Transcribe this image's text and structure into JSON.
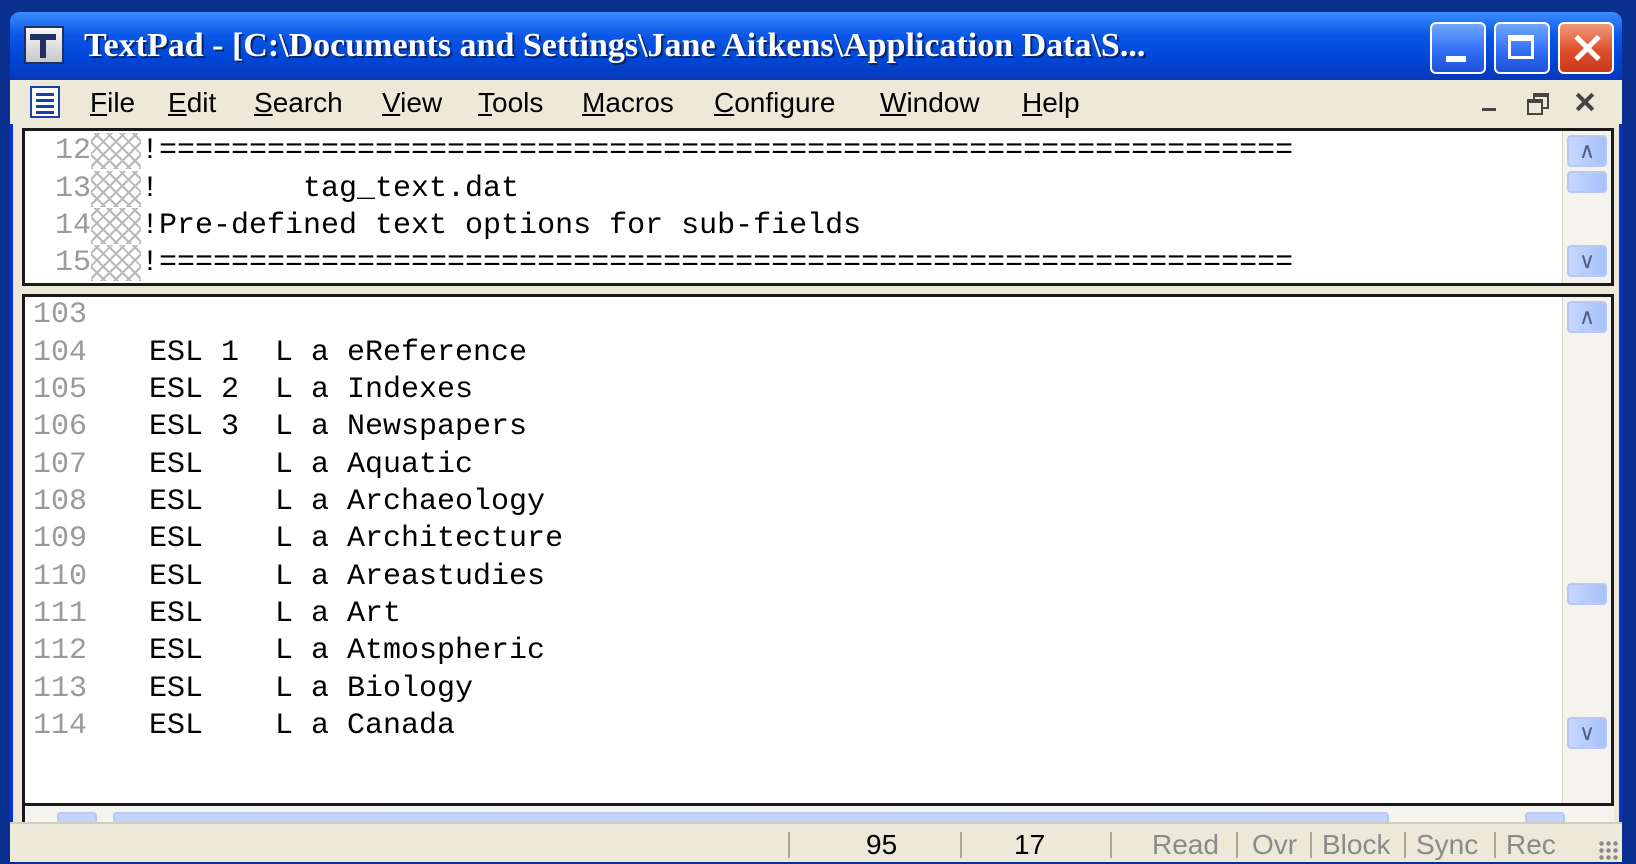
{
  "window": {
    "title": "TextPad - [C:\\Documents and Settings\\Jane Aitkens\\Application Data\\S..."
  },
  "menu": {
    "items": [
      {
        "key": "F",
        "rest": "ile"
      },
      {
        "key": "E",
        "rest": "dit"
      },
      {
        "key": "S",
        "rest": "earch"
      },
      {
        "key": "V",
        "rest": "iew"
      },
      {
        "key": "T",
        "rest": "ools"
      },
      {
        "key": "M",
        "rest": "acros"
      },
      {
        "key": "C",
        "rest": "onfigure"
      },
      {
        "key": "W",
        "rest": "indow"
      },
      {
        "key": "H",
        "rest": "elp"
      }
    ]
  },
  "top_pane": {
    "lines": [
      {
        "num": "12",
        "text": "!==============================================================="
      },
      {
        "num": "13",
        "text": "!        tag_text.dat"
      },
      {
        "num": "14",
        "text": "!Pre-defined text options for sub-fields"
      },
      {
        "num": "15",
        "text": "!==============================================================="
      }
    ]
  },
  "bottom_pane": {
    "lines": [
      {
        "num": "103",
        "text": ""
      },
      {
        "num": "104",
        "text": "ESL 1  L a eReference"
      },
      {
        "num": "105",
        "text": "ESL 2  L a Indexes"
      },
      {
        "num": "106",
        "text": "ESL 3  L a Newspapers"
      },
      {
        "num": "107",
        "text": "ESL    L a Aquatic"
      },
      {
        "num": "108",
        "text": "ESL    L a Archaeology"
      },
      {
        "num": "109",
        "text": "ESL    L a Architecture"
      },
      {
        "num": "110",
        "text": "ESL    L a Areastudies"
      },
      {
        "num": "111",
        "text": "ESL    L a Art"
      },
      {
        "num": "112",
        "text": "ESL    L a Atmospheric"
      },
      {
        "num": "113",
        "text": "ESL    L a Biology"
      },
      {
        "num": "114",
        "text": "ESL    L a Canada"
      }
    ]
  },
  "hscroll": {
    "thumb_grip": "IIII"
  },
  "status": {
    "line": "95",
    "column": "17",
    "read": "Read",
    "ovr": "Ovr",
    "block": "Block",
    "sync": "Sync",
    "rec": "Rec"
  }
}
